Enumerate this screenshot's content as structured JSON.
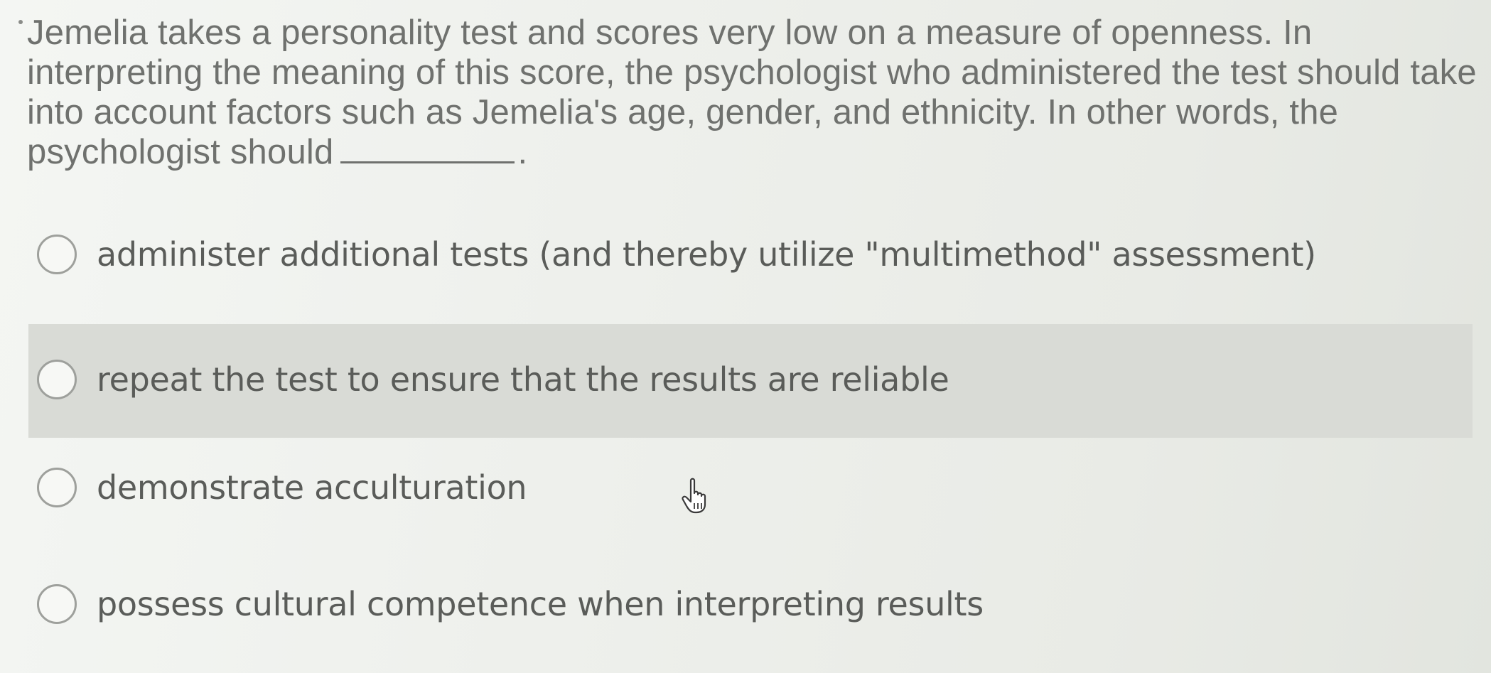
{
  "question": {
    "text": "Jemelia takes a personality test and scores very low on a measure of openness. In interpreting the meaning of this score, the psychologist who administered the test should take into account factors such as Jemelia's age, gender, and ethnicity. In other words, the psychologist should",
    "ending": "."
  },
  "options": [
    {
      "label": "administer additional tests (and thereby utilize \"multimethod\" assessment)",
      "selected": false
    },
    {
      "label": "repeat the test to ensure that the results are reliable",
      "selected": false,
      "hovered": true
    },
    {
      "label": "demonstrate acculturation",
      "selected": false
    },
    {
      "label": "possess cultural competence when interpreting results",
      "selected": false
    }
  ],
  "colors": {
    "text": "#6f716e",
    "hover_background": "#d9dbd6",
    "radio_border": "#9ea09c"
  },
  "icons": {
    "cursor": "hand-pointer-icon"
  }
}
